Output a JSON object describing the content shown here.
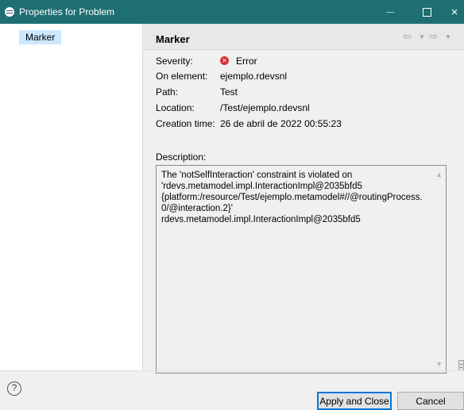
{
  "window": {
    "title": "Properties for Problem",
    "controls": {
      "minimize": "—",
      "maximize": "☐",
      "close": "×"
    }
  },
  "nav": {
    "items": [
      {
        "label": "Marker",
        "selected": true
      }
    ]
  },
  "panel": {
    "title": "Marker",
    "history": {
      "back": "⇦",
      "back_dropdown": "▼",
      "forward": "⇨",
      "forward_dropdown": "▼"
    },
    "properties": [
      {
        "label": "Severity:",
        "value": "Error",
        "icon": "error-icon"
      },
      {
        "label": "On element:",
        "value": "ejemplo.rdevsnl"
      },
      {
        "label": "Path:",
        "value": "Test"
      },
      {
        "label": "Location:",
        "value": "/Test/ejemplo.rdevsnl"
      },
      {
        "label": "Creation time:",
        "value": "26 de abril de 2022 00:55:23"
      }
    ],
    "description_label": "Description:",
    "description_text": "The 'notSelfInteraction' constraint is violated on\n'rdevs.metamodel.impl.InteractionImpl@2035bfd5\n{platform:/resource/Test/ejemplo.metamodel#//@routingProcess.\n0/@interaction.2}'\nrdevs.metamodel.impl.InteractionImpl@2035bfd5"
  },
  "footer": {
    "help_symbol": "?",
    "apply_label": "Apply and Close",
    "cancel_label": "Cancel"
  },
  "colors": {
    "titlebar": "#1f6f72",
    "selection": "#cce8ff",
    "error": "#d9302c",
    "default_button_border": "#0078d7"
  }
}
